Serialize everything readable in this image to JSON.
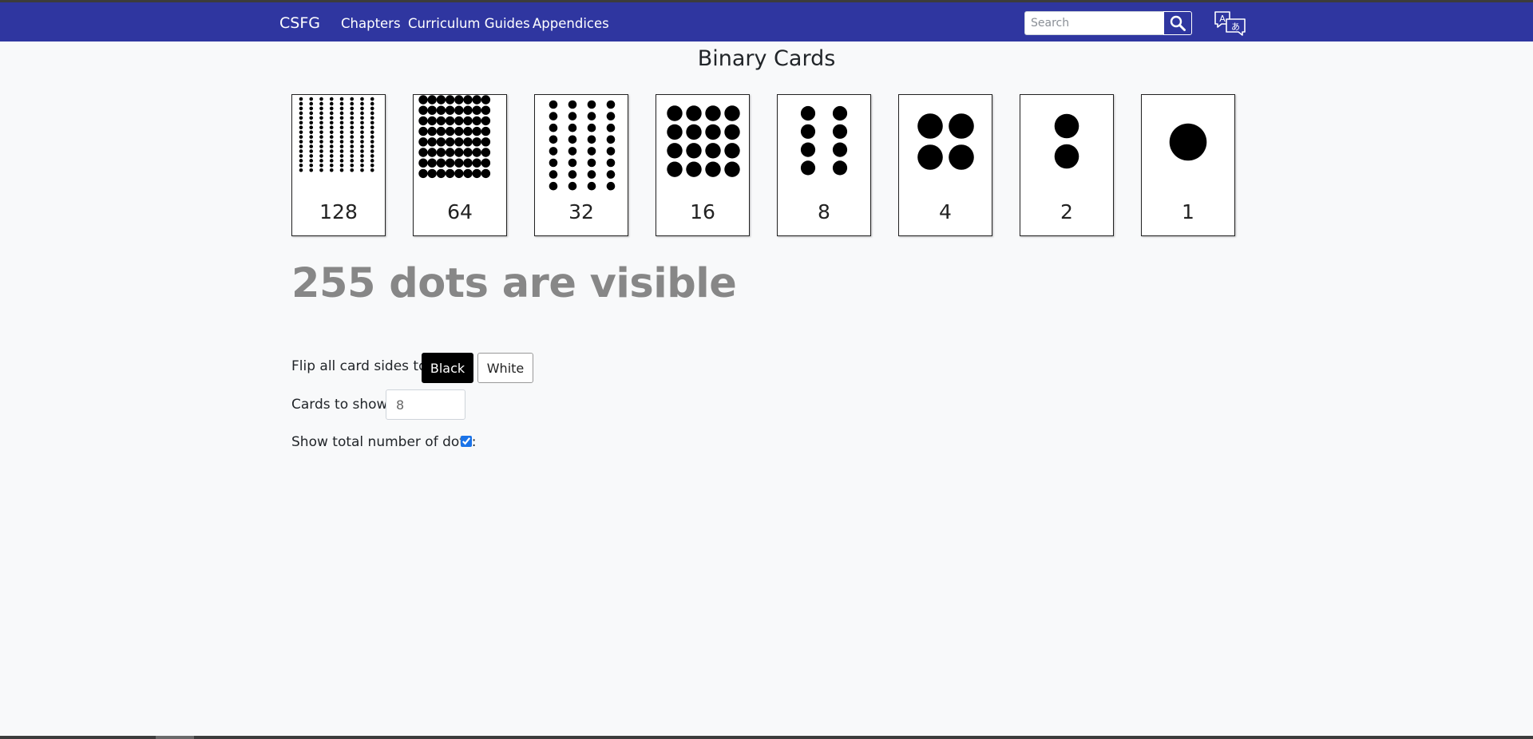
{
  "nav": {
    "brand": "CSFG",
    "links": [
      "Chapters",
      "Curriculum Guides",
      "Appendices"
    ],
    "search_placeholder": "Search",
    "bg_color": "#2f36a0"
  },
  "page": {
    "title": "Binary Cards",
    "cards": [
      {
        "value": "128",
        "cols": 8,
        "rows": 16
      },
      {
        "value": "64",
        "cols": 8,
        "rows": 8
      },
      {
        "value": "32",
        "cols": 4,
        "rows": 8
      },
      {
        "value": "16",
        "cols": 4,
        "rows": 4
      },
      {
        "value": "8",
        "cols": 2,
        "rows": 4
      },
      {
        "value": "4",
        "cols": 2,
        "rows": 2
      },
      {
        "value": "2",
        "cols": 1,
        "rows": 2
      },
      {
        "value": "1",
        "cols": 1,
        "rows": 1
      }
    ],
    "dots_visible_text": "255 dots are visible",
    "controls": {
      "flip_label": "Flip all card sides to:",
      "black_label": "Black",
      "white_label": "White",
      "cards_to_show_label": "Cards to show:",
      "cards_to_show_value": "8",
      "show_total_label": "Show total number of dots:",
      "show_total_checked": true
    }
  }
}
